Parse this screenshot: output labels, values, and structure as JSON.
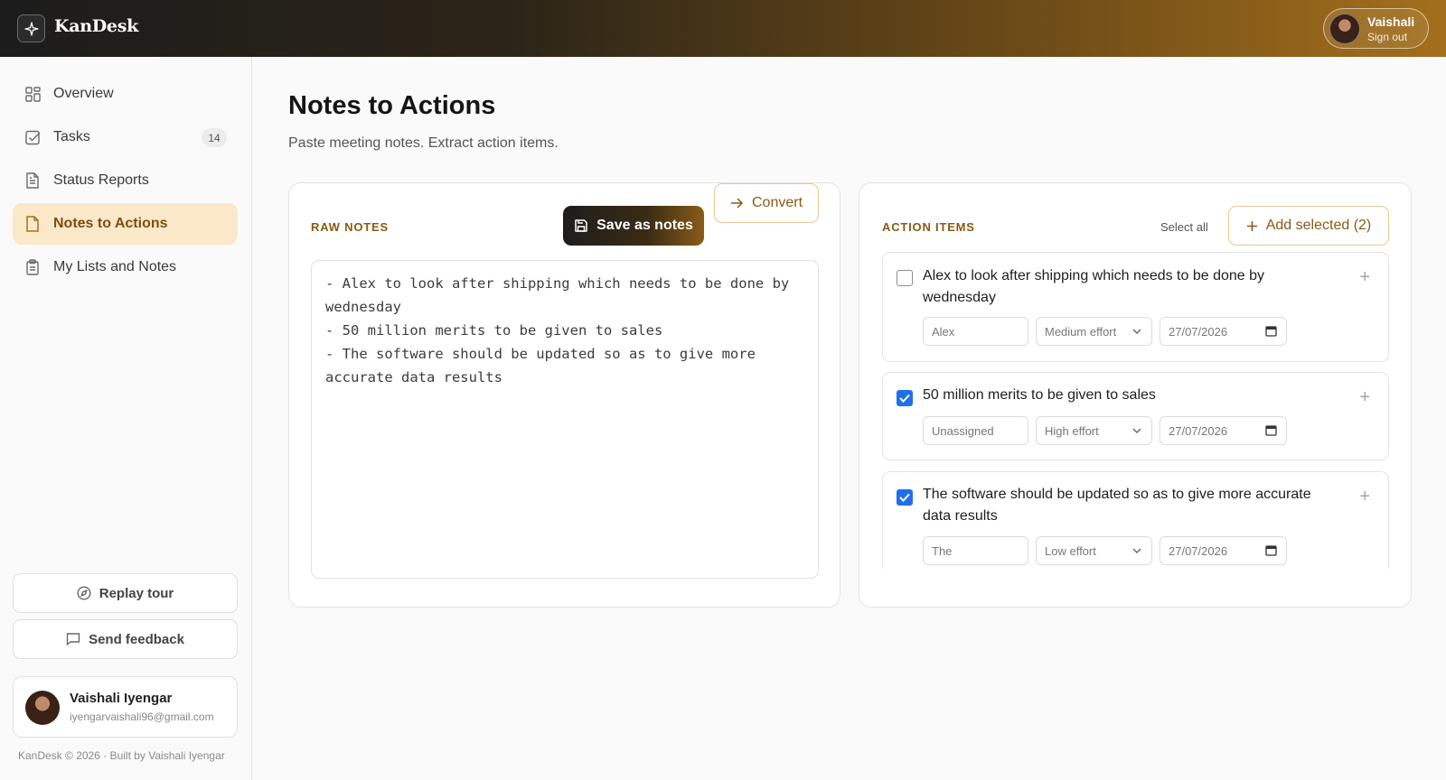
{
  "header": {
    "brand": "KanDesk",
    "user_name": "Vaishali",
    "sign_out": "Sign out"
  },
  "sidebar": {
    "items": [
      {
        "label": "Overview",
        "icon": "grid-icon"
      },
      {
        "label": "Tasks",
        "icon": "checkbox-icon",
        "badge": "14"
      },
      {
        "label": "Status Reports",
        "icon": "document-icon"
      },
      {
        "label": "Notes to Actions",
        "icon": "note-icon",
        "active": true
      },
      {
        "label": "My Lists and Notes",
        "icon": "clipboard-icon"
      }
    ],
    "replay_tour": "Replay tour",
    "send_feedback": "Send feedback",
    "profile_name": "Vaishali Iyengar",
    "profile_email": "iyengarvaishali96@gmail.com",
    "footer": "KanDesk © 2026 · Built by Vaishali Iyengar"
  },
  "page": {
    "title": "Notes to Actions",
    "subtitle": "Paste meeting notes. Extract action items."
  },
  "raw_notes": {
    "label": "RAW NOTES",
    "save_label": "Save as notes",
    "convert_label": "Convert",
    "text": "- Alex to look after shipping which needs to be done by wednesday\n- 50 million merits to be given to sales\n- The software should be updated so as to give more accurate data results"
  },
  "action_items": {
    "label": "ACTION ITEMS",
    "select_all": "Select all",
    "add_selected": "Add selected (2)",
    "items": [
      {
        "text": "Alex to look after shipping which needs to be done by wednesday",
        "checked": false,
        "assignee": "Alex",
        "effort": "Medium effort",
        "date": "27/07/2026"
      },
      {
        "text": "50 million merits to be given to sales",
        "checked": true,
        "assignee": "Unassigned",
        "effort": "High effort",
        "date": "27/07/2026"
      },
      {
        "text": "The software should be updated so as to give more accurate data results",
        "checked": true,
        "assignee": "The",
        "effort": "Low effort",
        "date": "27/07/2026"
      }
    ]
  },
  "colors": {
    "accent": "#a2701f",
    "active_bg": "#fbe8c9",
    "checkbox_blue": "#1f6feb"
  }
}
